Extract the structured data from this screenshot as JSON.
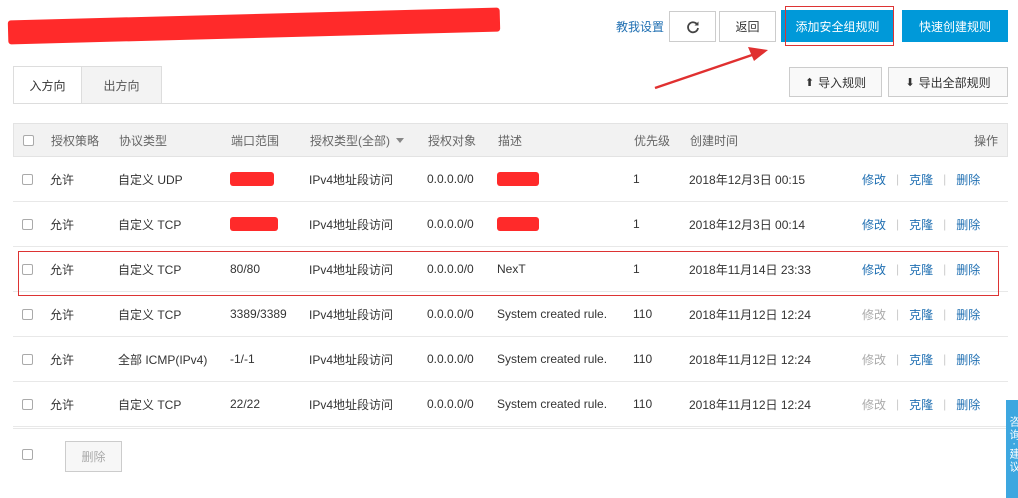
{
  "header": {
    "teach_link": "教我设置",
    "refresh_icon": "refresh-icon",
    "back_label": "返回",
    "add_rule_label": "添加安全组规则",
    "quick_create_label": "快速创建规则"
  },
  "tabs": [
    {
      "label": "入方向",
      "active": true
    },
    {
      "label": "出方向",
      "active": false
    }
  ],
  "toolbar": {
    "import_label": "导入规则",
    "export_label": "导出全部规则",
    "import_icon": "upload-icon",
    "export_icon": "download-icon"
  },
  "table": {
    "headers": {
      "policy": "授权策略",
      "protocol": "协议类型",
      "port": "端口范围",
      "auth_type": "授权类型(全部)",
      "target": "授权对象",
      "desc": "描述",
      "priority": "优先级",
      "created": "创建时间",
      "actions": "操作"
    },
    "rows": [
      {
        "policy": "允许",
        "protocol": "自定义 UDP",
        "port": "",
        "auth_type": "IPv4地址段访问",
        "target": "0.0.0.0/0",
        "desc": "",
        "priority": "1",
        "created": "2018年12月3日 00:15",
        "edit": "修改",
        "clone": "克隆",
        "delete": "删除",
        "edit_disabled": false
      },
      {
        "policy": "允许",
        "protocol": "自定义 TCP",
        "port": "",
        "auth_type": "IPv4地址段访问",
        "target": "0.0.0.0/0",
        "desc": "",
        "priority": "1",
        "created": "2018年12月3日 00:14",
        "edit": "修改",
        "clone": "克隆",
        "delete": "删除",
        "edit_disabled": false
      },
      {
        "policy": "允许",
        "protocol": "自定义 TCP",
        "port": "80/80",
        "auth_type": "IPv4地址段访问",
        "target": "0.0.0.0/0",
        "desc": "NexT",
        "priority": "1",
        "created": "2018年11月14日 23:33",
        "edit": "修改",
        "clone": "克隆",
        "delete": "删除",
        "edit_disabled": false
      },
      {
        "policy": "允许",
        "protocol": "自定义 TCP",
        "port": "3389/3389",
        "auth_type": "IPv4地址段访问",
        "target": "0.0.0.0/0",
        "desc": "System created rule.",
        "priority": "110",
        "created": "2018年11月12日 12:24",
        "edit": "修改",
        "clone": "克隆",
        "delete": "删除",
        "edit_disabled": true
      },
      {
        "policy": "允许",
        "protocol": "全部 ICMP(IPv4)",
        "port": "-1/-1",
        "auth_type": "IPv4地址段访问",
        "target": "0.0.0.0/0",
        "desc": "System created rule.",
        "priority": "110",
        "created": "2018年11月12日 12:24",
        "edit": "修改",
        "clone": "克隆",
        "delete": "删除",
        "edit_disabled": true
      },
      {
        "policy": "允许",
        "protocol": "自定义 TCP",
        "port": "22/22",
        "auth_type": "IPv4地址段访问",
        "target": "0.0.0.0/0",
        "desc": "System created rule.",
        "priority": "110",
        "created": "2018年11月12日 12:24",
        "edit": "修改",
        "clone": "克隆",
        "delete": "删除",
        "edit_disabled": true
      }
    ]
  },
  "footer": {
    "delete_label": "删除"
  },
  "consult_widget": {
    "label": "咨询·建议"
  },
  "colors": {
    "primary": "#0099d9",
    "link": "#1f6fb2",
    "annotation_red": "#e03030"
  }
}
